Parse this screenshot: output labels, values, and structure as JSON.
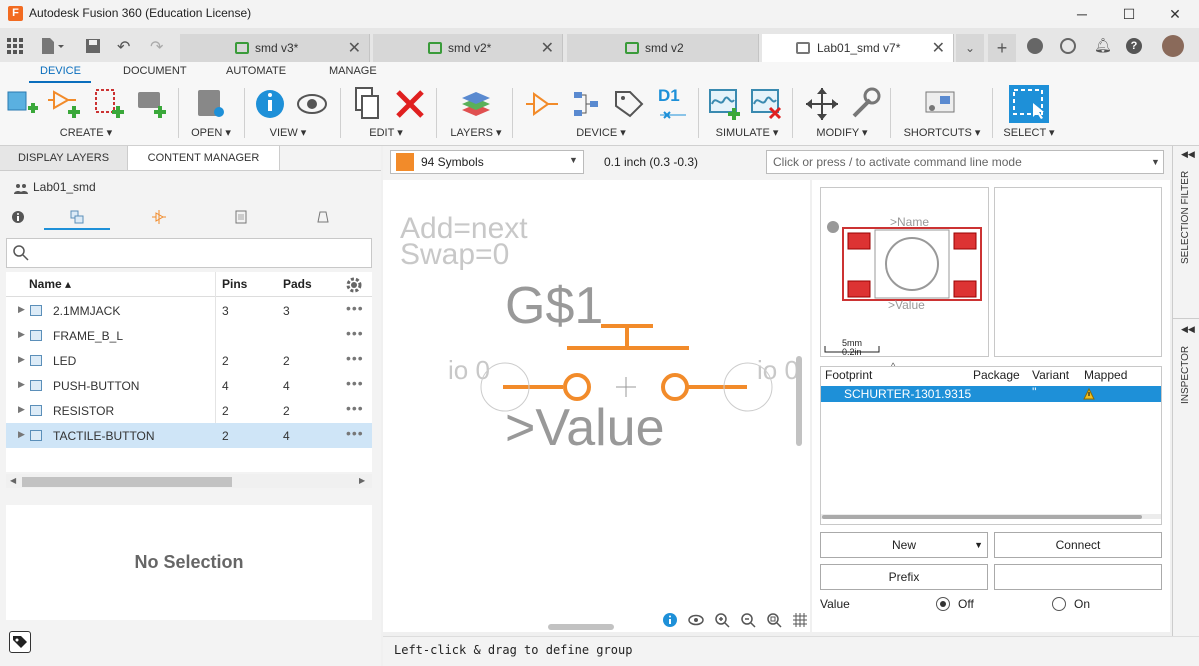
{
  "window": {
    "title": "Autodesk Fusion 360 (Education License)",
    "app_icon_letter": "F",
    "minimize": "─",
    "maximize": "☐",
    "close": "✕"
  },
  "doc_tabs": [
    {
      "label": "smd v3*",
      "close": "✕"
    },
    {
      "label": "smd v2*",
      "close": "✕"
    },
    {
      "label": "smd v2",
      "close": ""
    },
    {
      "label": "Lab01_smd v7*",
      "close": "✕"
    }
  ],
  "ribbon": {
    "tabs": [
      "DEVICE",
      "DOCUMENT",
      "AUTOMATE",
      "MANAGE"
    ],
    "groups": [
      "CREATE ▾",
      "OPEN ▾",
      "VIEW ▾",
      "EDIT ▾",
      "LAYERS ▾",
      "DEVICE ▾",
      "SIMULATE ▾",
      "MODIFY ▾",
      "SHORTCUTS ▾",
      "SELECT ▾"
    ],
    "d1_label": "D1"
  },
  "left_panel": {
    "tabs": [
      "DISPLAY LAYERS",
      "CONTENT MANAGER"
    ],
    "library_name": "Lab01_smd",
    "columns": {
      "name": "Name ▴",
      "pins": "Pins",
      "pads": "Pads"
    },
    "rows": [
      {
        "name": "2.1MMJACK",
        "pins": "3",
        "pads": "3"
      },
      {
        "name": "FRAME_B_L",
        "pins": "",
        "pads": ""
      },
      {
        "name": "LED",
        "pins": "2",
        "pads": "2"
      },
      {
        "name": "PUSH-BUTTON",
        "pins": "4",
        "pads": "4"
      },
      {
        "name": "RESISTOR",
        "pins": "2",
        "pads": "2"
      },
      {
        "name": "TACTILE-BUTTON",
        "pins": "2",
        "pads": "4"
      }
    ],
    "no_selection": "No Selection"
  },
  "command_bar": {
    "layer": "94 Symbols",
    "layer_color": "#f28b2a",
    "coordinates": "0.1 inch (0.3 -0.3)",
    "command_placeholder": "Click or press / to activate command line mode"
  },
  "canvas": {
    "add_text": "Add=next",
    "swap_text": "Swap=0",
    "name_text": "G$1",
    "value_text": ">Value",
    "pin_left": "io 0",
    "pin_right": "io 0"
  },
  "preview": {
    "name_label": ">Name",
    "value_label": ">Value",
    "scale_mm": "5mm",
    "scale_in": "0.2in"
  },
  "footprint_table": {
    "columns": [
      "Footprint",
      "Package",
      "Variant",
      "Mapped"
    ],
    "row": {
      "footprint": "SCHURTER-1301.9315",
      "variant": "''"
    }
  },
  "right_buttons": {
    "new": "New",
    "connect": "Connect",
    "prefix": "Prefix",
    "value_label": "Value",
    "off": "Off",
    "on": "On"
  },
  "sidebar": {
    "selection_filter": "SELECTION FILTER",
    "inspector": "INSPECTOR"
  },
  "status": "Left-click & drag to define group"
}
